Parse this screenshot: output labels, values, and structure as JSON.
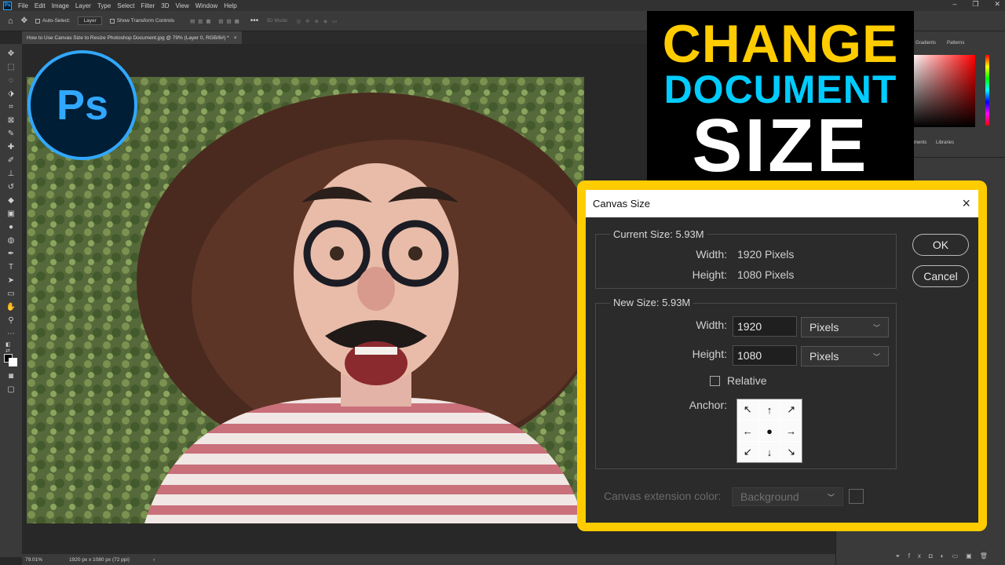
{
  "app": {
    "logo_text": "Ps",
    "menu": [
      "File",
      "Edit",
      "Image",
      "Layer",
      "Type",
      "Select",
      "Filter",
      "3D",
      "View",
      "Window",
      "Help"
    ]
  },
  "options_bar": {
    "auto_select_label": "Auto-Select:",
    "layer_dropdown": "Layer",
    "transform_label": "Show Transform Controls",
    "mode_3d": "3D Mode:"
  },
  "document_tab": {
    "title": "How to Use Canvas Size to Resize Photoshop Document.jpg @ 79% (Layer 0, RGB/8#) *",
    "close": "×"
  },
  "status": {
    "zoom": "79.01%",
    "doc_info": "1920 px x 1080 px (72 ppi)"
  },
  "panels": {
    "tabs_top": [
      "Gradients",
      "Patterns"
    ],
    "tabs_mid": [
      "ments",
      "Libraries"
    ]
  },
  "overlay": {
    "ps_logo": "Ps",
    "title_line1": "CHANGE",
    "title_line2": "DOCUMENT",
    "title_line3": "SIZE",
    "title_colors": {
      "line1": "#ffcc00",
      "line2": "#00ccff",
      "line3": "#ffffff"
    }
  },
  "dialog": {
    "title": "Canvas Size",
    "close_icon": "×",
    "current_size": {
      "label": "Current Size: 5.93M",
      "width_label": "Width:",
      "width_value": "1920 Pixels",
      "height_label": "Height:",
      "height_value": "1080 Pixels"
    },
    "new_size": {
      "label": "New Size: 5.93M",
      "width_label": "Width:",
      "width_value": "1920",
      "width_unit": "Pixels",
      "height_label": "Height:",
      "height_value": "1080",
      "height_unit": "Pixels",
      "relative_label": "Relative",
      "relative_checked": false,
      "anchor_label": "Anchor:",
      "anchor_icons": [
        "arrow-up-left",
        "arrow-up",
        "arrow-up-right",
        "arrow-left",
        "anchor-center-dot",
        "arrow-right",
        "arrow-down-left",
        "arrow-down",
        "arrow-down-right"
      ]
    },
    "extension_color_label": "Canvas extension color:",
    "extension_color_value": "Background",
    "ok_label": "OK",
    "cancel_label": "Cancel"
  }
}
